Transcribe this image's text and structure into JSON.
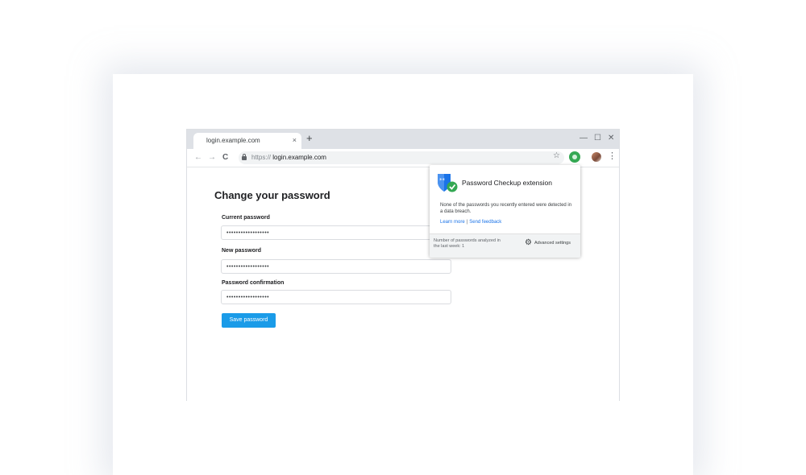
{
  "browser": {
    "tab_title": "login.example.com",
    "tab_close": "×",
    "new_tab": "+",
    "window_controls": {
      "minimize": "—",
      "maximize": "☐",
      "close": "✕"
    },
    "nav": {
      "back": "←",
      "forward": "→",
      "reload": "C"
    },
    "url_scheme": "https://",
    "url_host": " login.example.com",
    "star": "☆",
    "menu": "⋮"
  },
  "page": {
    "title": "Change your password",
    "fields": [
      {
        "label": "Current password",
        "value": "••••••••••••••••••"
      },
      {
        "label": "New password",
        "value": "••••••••••••••••••"
      },
      {
        "label": "Password confirmation",
        "value": "••••••••••••••••••"
      }
    ],
    "save_label": "Save password"
  },
  "popup": {
    "title": "Password Checkup extension",
    "message": "None of the passwords you recently entered were detected in a data breach.",
    "learn_more": "Learn more",
    "separator": "|",
    "send_feedback": "Send feedback",
    "footer_note": "Number of passwords analyzed in the last week: 1",
    "gear": "⚙",
    "advanced_settings": "Advanced settings"
  },
  "icons": {
    "shield": "shield-check-icon",
    "extension": "password-checkup-extension-icon",
    "lock": "lock-icon",
    "avatar": "avatar"
  },
  "colors": {
    "accent": "#1a9be8",
    "shield_blue": "#1a73e8",
    "check_green": "#34a853",
    "link": "#1a73e8"
  }
}
